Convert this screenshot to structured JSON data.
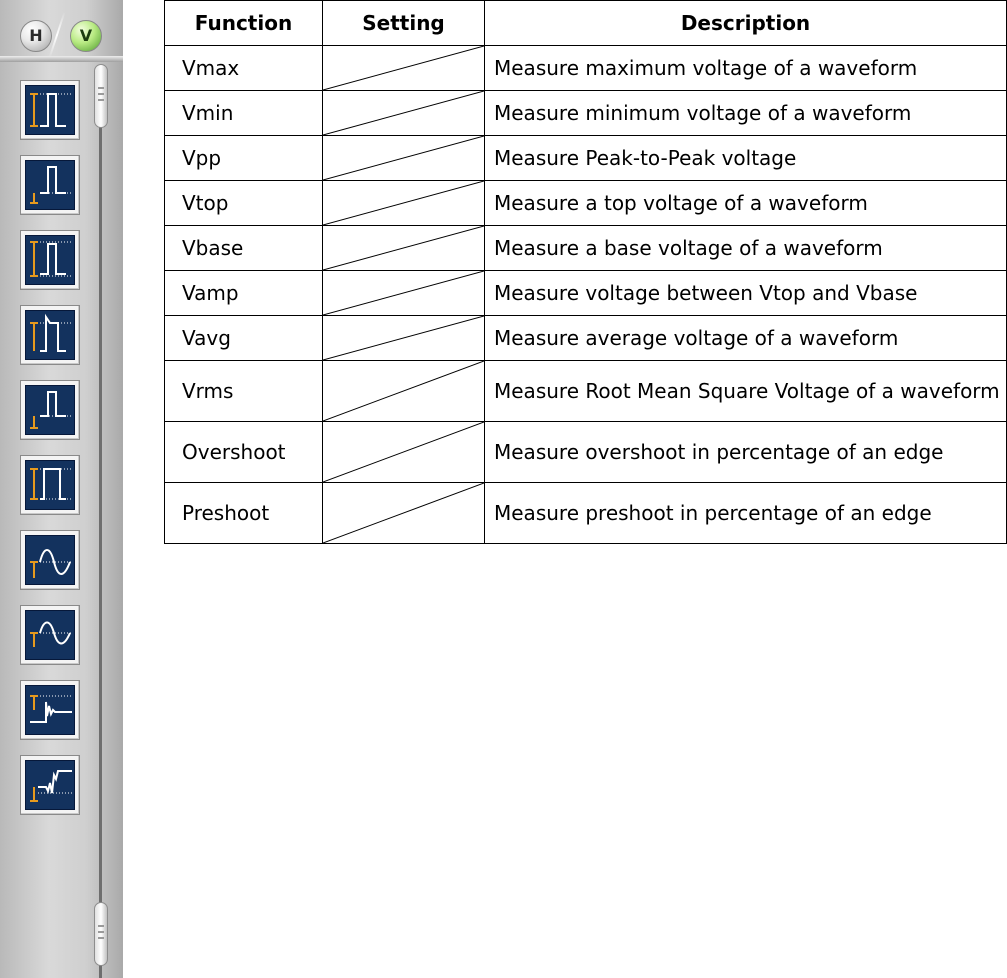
{
  "panel": {
    "tabs": {
      "h_label": "H",
      "v_label": "V",
      "active": "V"
    },
    "items": [
      {
        "icon": "vmax-measurement-icon"
      },
      {
        "icon": "vmin-measurement-icon"
      },
      {
        "icon": "vpp-measurement-icon"
      },
      {
        "icon": "vtop-measurement-icon"
      },
      {
        "icon": "vbase-measurement-icon"
      },
      {
        "icon": "vamp-measurement-icon"
      },
      {
        "icon": "vavg-measurement-icon"
      },
      {
        "icon": "vrms-measurement-icon"
      },
      {
        "icon": "overshoot-measurement-icon"
      },
      {
        "icon": "preshoot-measurement-icon"
      }
    ],
    "colors": {
      "screen": "#13325e",
      "trace": "#ffffff",
      "marker": "#e69a1e",
      "active_tab": "#7ccd4a"
    }
  },
  "table": {
    "headers": {
      "function": "Function",
      "setting": "Setting",
      "description": "Description"
    },
    "rows": [
      {
        "function": "Vmax",
        "setting": "",
        "description": "Measure maximum voltage of a waveform"
      },
      {
        "function": "Vmin",
        "setting": "",
        "description": "Measure minimum voltage of a waveform"
      },
      {
        "function": "Vpp",
        "setting": "",
        "description": "Measure Peak-to-Peak voltage"
      },
      {
        "function": "Vtop",
        "setting": "",
        "description": "Measure a top voltage of a waveform"
      },
      {
        "function": "Vbase",
        "setting": "",
        "description": "Measure a base voltage of a waveform"
      },
      {
        "function": "Vamp",
        "setting": "",
        "description": "Measure voltage between Vtop and Vbase"
      },
      {
        "function": "Vavg",
        "setting": "",
        "description": "Measure average voltage of a waveform"
      },
      {
        "function": "Vrms",
        "setting": "",
        "description": "Measure Root Mean Square Voltage of a waveform"
      },
      {
        "function": "Overshoot",
        "setting": "",
        "description": "Measure overshoot in percentage of an edge"
      },
      {
        "function": "Preshoot",
        "setting": "",
        "description": "Measure preshoot in percentage of an edge"
      }
    ]
  }
}
